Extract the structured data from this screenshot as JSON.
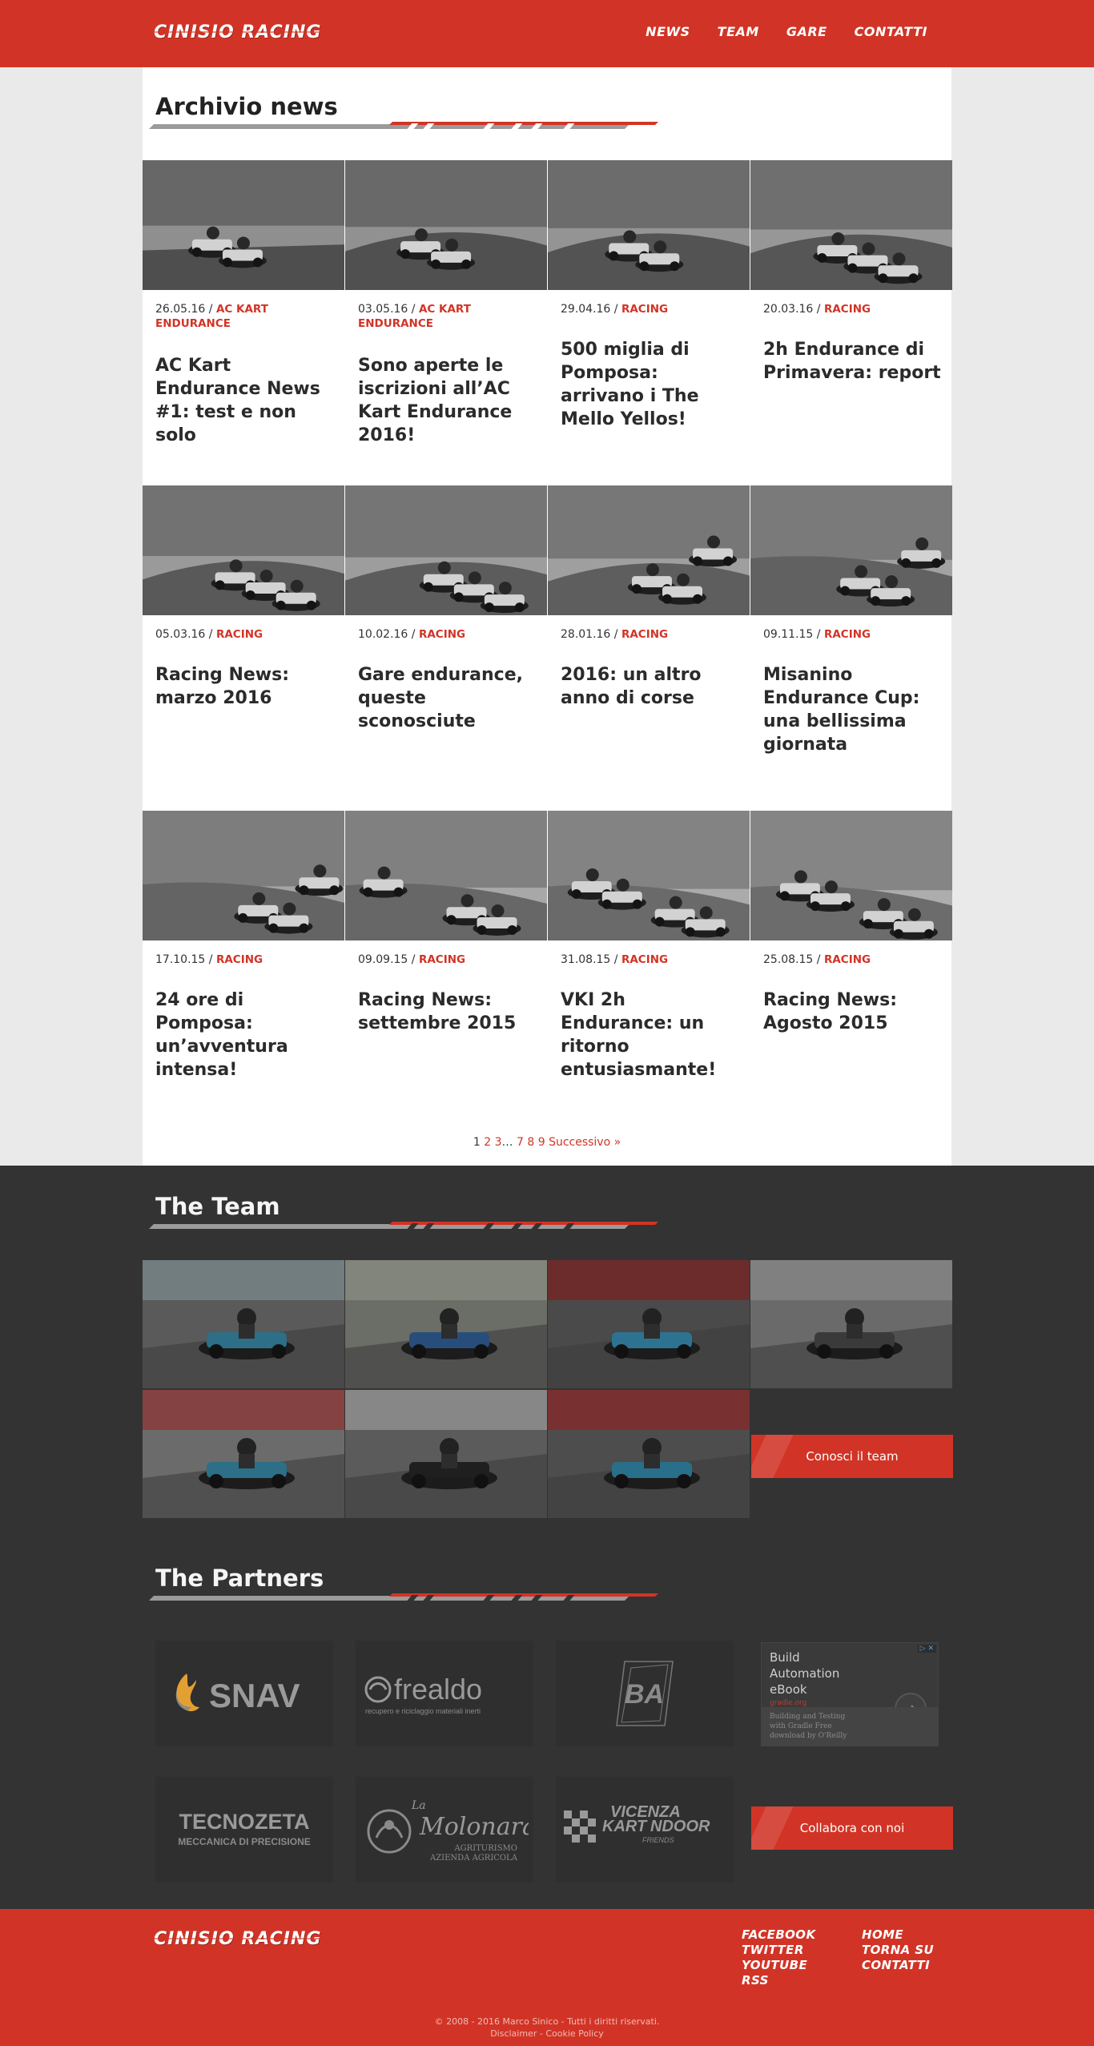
{
  "brand": {
    "name": "CINISIO RACING"
  },
  "nav": [
    {
      "label": "NEWS"
    },
    {
      "label": "TEAM"
    },
    {
      "label": "GARE"
    },
    {
      "label": "CONTATTI"
    }
  ],
  "archive": {
    "title": "Archivio news",
    "posts": [
      {
        "date": "26.05.16",
        "category": "AC KART ENDURANCE",
        "title": "AC Kart Endurance News #1: test e non solo"
      },
      {
        "date": "03.05.16",
        "category": "AC KART ENDURANCE",
        "title": "Sono aperte le iscrizioni all’AC Kart Endurance 2016!"
      },
      {
        "date": "29.04.16",
        "category": "RACING",
        "title": "500 miglia di Pomposa: arrivano i The Mello Yellos!"
      },
      {
        "date": "20.03.16",
        "category": "RACING",
        "title": "2h Endurance di Primavera: report"
      },
      {
        "date": "05.03.16",
        "category": "RACING",
        "title": "Racing News: marzo 2016"
      },
      {
        "date": "10.02.16",
        "category": "RACING",
        "title": "Gare endurance, queste sconosciute"
      },
      {
        "date": "28.01.16",
        "category": "RACING",
        "title": "2016: un altro anno di corse"
      },
      {
        "date": "09.11.15",
        "category": "RACING",
        "title": "Misanino Endurance Cup: una bellissima giornata"
      },
      {
        "date": "17.10.15",
        "category": "RACING",
        "title": "24 ore di Pomposa: un’avventura intensa!"
      },
      {
        "date": "09.09.15",
        "category": "RACING",
        "title": "Racing News: settembre 2015"
      },
      {
        "date": "31.08.15",
        "category": "RACING",
        "title": "VKI 2h Endurance: un ritorno entusiasmante!"
      },
      {
        "date": "25.08.15",
        "category": "RACING",
        "title": "Racing News: Agosto 2015"
      }
    ],
    "pager": {
      "current": "1",
      "p2": "2",
      "p3": "3",
      "ellipsis": "…",
      "p7": "7",
      "p8": "8",
      "p9": "9",
      "next": "Successivo »"
    }
  },
  "team": {
    "title": "The Team",
    "cta": "Conosci il team"
  },
  "partners": {
    "title": "The Partners",
    "logos": [
      {
        "name": "SNAV"
      },
      {
        "name": "frealdo",
        "tagline": "recupero e riciclaggio materiali inerti"
      },
      {
        "name": "BA"
      },
      {
        "name": "TECNOZETA",
        "tagline": "MECCANICA DI PRECISIONE"
      },
      {
        "name": "Molonara",
        "prefix": "La",
        "tagline1": "AGRITURISMO",
        "tagline2": "AZIENDA AGRICOLA"
      },
      {
        "name1": "VICENZA",
        "name2": "KART",
        "name3": "NDOOR",
        "tagline": "FRIENDS"
      }
    ],
    "cta": "Collabora con noi",
    "ad": {
      "headline1": "Build",
      "headline2": "Automation",
      "headline3": "eBook",
      "url": "gradle.org",
      "body1": "Building and Testing",
      "body2": "with Gradle Free",
      "body3": "download by O'Reilly",
      "badge": "▷ ✕",
      "arrow": "➜"
    }
  },
  "footer": {
    "links_left": [
      "FACEBOOK",
      "TWITTER",
      "YOUTUBE",
      "RSS"
    ],
    "links_right": [
      "HOME",
      "TORNA SU",
      "CONTATTI"
    ],
    "copyright": "© 2008 - 2016 Marco Sinico - Tutti i diritti riservati.",
    "legal": "Disclaimer - Cookie Policy"
  },
  "colors": {
    "accent": "#d13426",
    "dark": "#333333",
    "page": "#eaeaea"
  }
}
